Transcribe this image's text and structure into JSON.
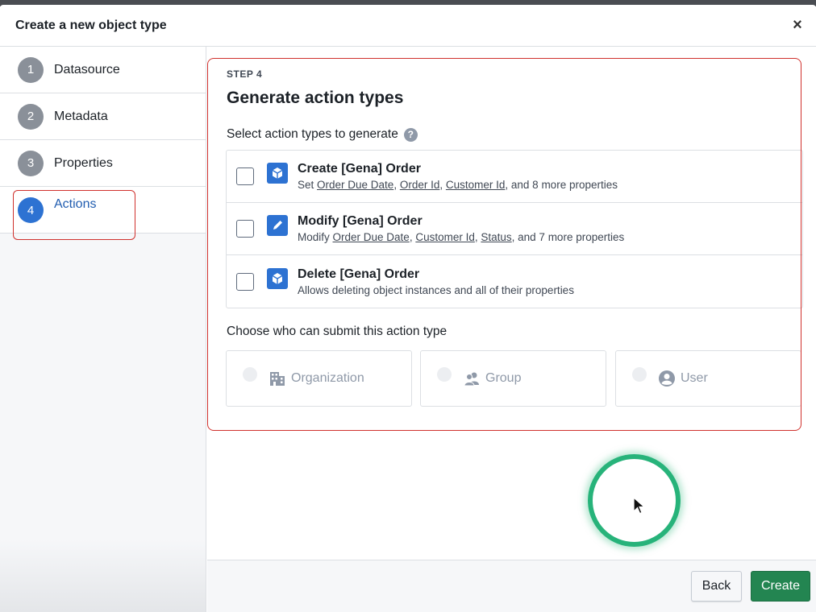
{
  "dialog": {
    "title": "Create a new object type",
    "close_glyph": "×"
  },
  "steps": [
    {
      "number": "1",
      "label": "Datasource"
    },
    {
      "number": "2",
      "label": "Metadata"
    },
    {
      "number": "3",
      "label": "Properties"
    },
    {
      "number": "4",
      "label": "Actions",
      "active": true
    }
  ],
  "main": {
    "step_kicker": "STEP 4",
    "title": "Generate action types",
    "select_label": "Select action types to generate",
    "help_glyph": "?",
    "actions": [
      {
        "title": "Create [Gena] Order",
        "icon": "cube-icon",
        "desc_prefix": "Set ",
        "props": [
          "Order Due Date",
          "Order Id",
          "Customer Id"
        ],
        "desc_suffix": ", and 8 more properties"
      },
      {
        "title": "Modify [Gena] Order",
        "icon": "pencil-icon",
        "desc_prefix": "Modify ",
        "props": [
          "Order Due Date",
          "Customer Id",
          "Status"
        ],
        "desc_suffix": ", and 7 more properties"
      },
      {
        "title": "Delete [Gena] Order",
        "icon": "cube-icon",
        "desc": "Allows deleting object instances and all of their properties"
      }
    ],
    "submit_label": "Choose who can submit this action type",
    "submitters": [
      {
        "label": "Organization",
        "icon": "building-icon"
      },
      {
        "label": "Group",
        "icon": "people-icon"
      },
      {
        "label": "User",
        "icon": "user-icon"
      }
    ]
  },
  "footer": {
    "back_label": "Back",
    "create_label": "Create"
  },
  "colors": {
    "accent_blue": "#2d72d2",
    "create_green": "#238551",
    "highlight_red": "#d0312d",
    "click_ring": "#27b37a"
  }
}
